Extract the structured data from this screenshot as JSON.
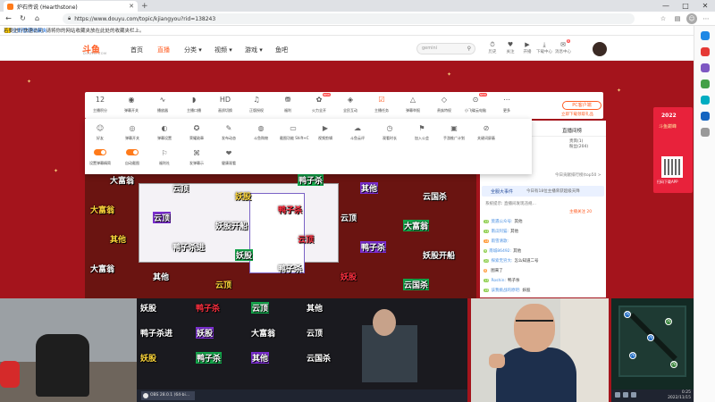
{
  "browser": {
    "tab_title": "炉石传说 (Hearthstone)",
    "url": "https://www.douyu.com/topic/kjiangyou?rid=138243",
    "window_controls": [
      "—",
      "□",
      "✕"
    ]
  },
  "infobar": {
    "message": "若要进行快速访问, 请将你的网站收藏夹放在此处的收藏夹栏上。",
    "button": "立即管理收藏夹"
  },
  "site": {
    "logo": "斗鱼",
    "logo_sub": "DOUYU.COM",
    "nav": [
      {
        "label": "首页",
        "active": false
      },
      {
        "label": "直播",
        "active": true
      },
      {
        "label": "分类 ▾",
        "active": false
      },
      {
        "label": "视频 ▾",
        "active": false
      },
      {
        "label": "游戏 ▾",
        "active": false
      },
      {
        "label": "鱼吧",
        "active": false
      }
    ],
    "search_placeholder": "gemini",
    "top_icons": [
      {
        "label": "历史",
        "icon": "⏱",
        "badge": ""
      },
      {
        "label": "关注",
        "icon": "♥",
        "badge": ""
      },
      {
        "label": "开播",
        "icon": "▶",
        "badge": ""
      },
      {
        "label": "下载中心",
        "icon": "⤓",
        "badge": ""
      },
      {
        "label": "消息中心",
        "icon": "✉",
        "badge": "8"
      }
    ]
  },
  "toolbar": {
    "items": [
      {
        "label": "主播积分",
        "icon": "12",
        "hot": ""
      },
      {
        "label": "弹幕开关",
        "icon": "◉",
        "hot": ""
      },
      {
        "label": "播放器",
        "icon": "∿",
        "hot": ""
      },
      {
        "label": "主播口播",
        "icon": "◗",
        "hot": ""
      },
      {
        "label": "画质切换",
        "icon": "HD",
        "hot": ""
      },
      {
        "label": "正版授权",
        "icon": "♫",
        "hot": ""
      },
      {
        "label": "福利",
        "icon": "⛃",
        "hot": ""
      },
      {
        "label": "火力全开",
        "icon": "✿",
        "hot": "NEW"
      },
      {
        "label": "全民互动",
        "icon": "◈",
        "hot": ""
      },
      {
        "label": "主播任务",
        "icon": "☑",
        "hot": ""
      },
      {
        "label": "弹幕举报",
        "icon": "△",
        "hot": ""
      },
      {
        "label": "贵族特权",
        "icon": "◇",
        "hot": ""
      },
      {
        "label": "小飞碟云电脑",
        "icon": "⊙",
        "hot": "NEW"
      },
      {
        "label": "更多",
        "icon": "⋯",
        "hot": ""
      }
    ],
    "pc_button": "PC客户端",
    "pc_sub": "立即下载领取礼品"
  },
  "dropdown": {
    "row1": [
      {
        "label": "好友",
        "icon": "☺"
      },
      {
        "label": "弹幕开关",
        "icon": "◎"
      },
      {
        "label": "弹幕设置",
        "icon": "◐"
      },
      {
        "label": "荣耀勋章",
        "icon": "✪"
      },
      {
        "label": "发布动态",
        "icon": "✎"
      },
      {
        "label": "斗鱼购物",
        "icon": "◍"
      },
      {
        "label": "截图功能 Shift+C",
        "icon": "▭"
      },
      {
        "label": "视频剪辑",
        "icon": "▶"
      },
      {
        "label": "斗鱼云评",
        "icon": "☁"
      },
      {
        "label": "观看时长",
        "icon": "◷"
      },
      {
        "label": "加入公会",
        "icon": "⚑"
      },
      {
        "label": "手游推广计划",
        "icon": "▣"
      },
      {
        "label": "关键词屏蔽",
        "icon": "⊘"
      }
    ],
    "row2": [
      {
        "label": "设置弹幕精简",
        "icon": "toggle"
      },
      {
        "label": "自动截图",
        "icon": "toggle"
      },
      {
        "label": "福利社",
        "icon": "⚐"
      },
      {
        "label": "发弹幕示",
        "icon": "⌘"
      },
      {
        "label": "健康观看",
        "icon": "❤"
      }
    ]
  },
  "chat": {
    "rank_tab": "直播间榜",
    "rank_rows": [
      "贵宾(1)",
      "粉丝(204)"
    ],
    "note_top": "今日贡献排行榜(top50 >",
    "gift_title": "全服大事件",
    "gift_note": "今日有18位主播荣获超级天降",
    "note_mid": "系统提示: 直播间发现违规…",
    "subs": "主播关注 20",
    "messages": [
      {
        "lvl": "12",
        "fans": "",
        "nick": "莫遇公众号:",
        "text": "其他",
        "orange": false
      },
      {
        "lvl": "11",
        "fans": "",
        "nick": "南瓜阿猫:",
        "text": "其他",
        "orange": false
      },
      {
        "lvl": "14",
        "fans": "",
        "nick": "雨雪清歌:",
        "text": "",
        "orange": false
      },
      {
        "lvl": "9",
        "fans": "",
        "nick": "南城86492:",
        "text": "其他",
        "orange": false
      },
      {
        "lvl": "20",
        "fans": "",
        "nick": "探索无穷大:",
        "text": "怎么知道二号",
        "orange": false
      },
      {
        "lvl": "8",
        "fans": "",
        "nick": "",
        "text": "图来了",
        "orange": false
      },
      {
        "lvl": "13",
        "fans": "",
        "nick": "Roshin:",
        "text": "鸭子杀",
        "orange": false
      },
      {
        "lvl": "15",
        "fans": "",
        "nick": "该我挑战的原吧:",
        "text": "妖股",
        "orange": false
      }
    ]
  },
  "promo": {
    "year": "2022",
    "slogan": "斗鱼巅峰",
    "qr_label": "扫码下载APP"
  },
  "danmaku": [
    {
      "t": "妖股",
      "s": "n"
    },
    {
      "t": "鸭子杀",
      "s": "r"
    },
    {
      "t": "云顶",
      "s": "g"
    },
    {
      "t": "其他",
      "s": "n"
    },
    {
      "t": "鸭子杀进",
      "s": "n"
    },
    {
      "t": "妖股",
      "s": "p"
    },
    {
      "t": "大富翁",
      "s": "n"
    },
    {
      "t": "云顶",
      "s": "n"
    },
    {
      "t": "妖股",
      "s": "y"
    },
    {
      "t": "鸭子杀",
      "s": "g"
    },
    {
      "t": "其他",
      "s": "p"
    },
    {
      "t": "云国杀",
      "s": "n"
    },
    {
      "t": "大富翁",
      "s": "y"
    },
    {
      "t": "云顶",
      "s": "p"
    },
    {
      "t": "妖股开船",
      "s": "n"
    },
    {
      "t": "鸭子杀",
      "s": "r"
    },
    {
      "t": "云顶",
      "s": "n"
    },
    {
      "t": "大富翁",
      "s": "g"
    },
    {
      "t": "其他",
      "s": "y"
    },
    {
      "t": "鸭子杀进",
      "s": "n"
    },
    {
      "t": "妖股",
      "s": "g"
    },
    {
      "t": "云顶",
      "s": "r"
    },
    {
      "t": "鸭子杀",
      "s": "p"
    },
    {
      "t": "妖股开船",
      "s": "n"
    },
    {
      "t": "大富翁",
      "s": "n"
    },
    {
      "t": "其他",
      "s": "n"
    },
    {
      "t": "云顶",
      "s": "y"
    },
    {
      "t": "鸭子杀",
      "s": "n"
    },
    {
      "t": "妖股",
      "s": "r"
    },
    {
      "t": "云国杀",
      "s": "g"
    }
  ],
  "taskbar": {
    "app": "OBS 28.0.1 (64-bi…"
  },
  "system": {
    "time": "0:25",
    "date": "2022/11/15"
  },
  "minimap": {
    "markers": [
      "76",
      "76",
      "76",
      "76",
      "76"
    ]
  }
}
